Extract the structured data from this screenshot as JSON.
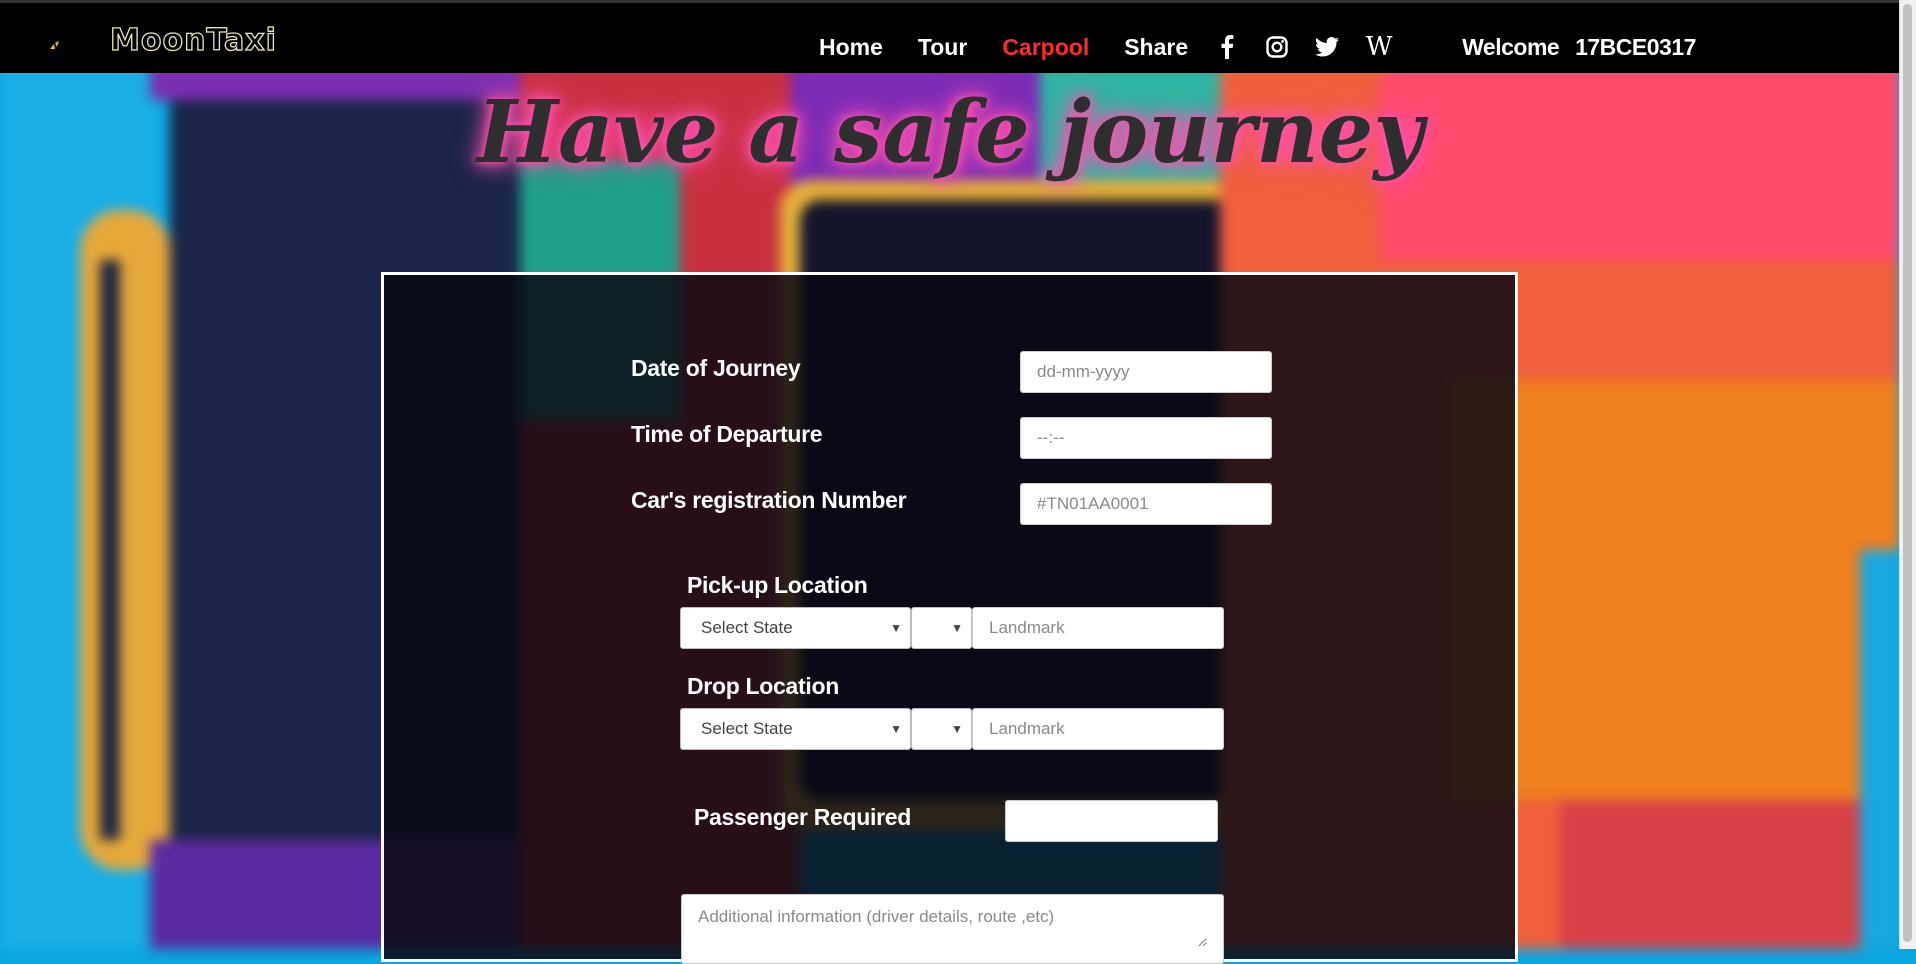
{
  "nav": {
    "brand": "MoonTaxi",
    "links": [
      "Home",
      "Tour",
      "Carpool",
      "Share"
    ],
    "active_link": "Carpool",
    "social_icons": [
      "facebook-icon",
      "instagram-icon",
      "twitter-icon",
      "wikipedia-icon"
    ],
    "welcome_label": "Welcome",
    "username": "17BCE0317"
  },
  "heading": "Have a safe journey",
  "form": {
    "date_label": "Date of Journey",
    "date_placeholder": "dd-mm-yyyy",
    "time_label": "Time of Departure",
    "time_placeholder": "--:--",
    "reg_label": "Car's registration Number",
    "reg_placeholder": "#TN01AA0001",
    "pickup_label": "Pick-up Location",
    "pickup_state": "Select State",
    "pickup_city": "",
    "pickup_landmark_placeholder": "Landmark",
    "drop_label": "Drop Location",
    "drop_state": "Select State",
    "drop_city": "",
    "drop_landmark_placeholder": "Landmark",
    "passengers_label": "Passenger Required",
    "passengers_value": "",
    "additional_placeholder": "Additional information (driver details, route ,etc)"
  },
  "colors": {
    "active_link": "#ff2b2b",
    "heading_glow": "#ff52b1",
    "navbar": "#000000"
  }
}
